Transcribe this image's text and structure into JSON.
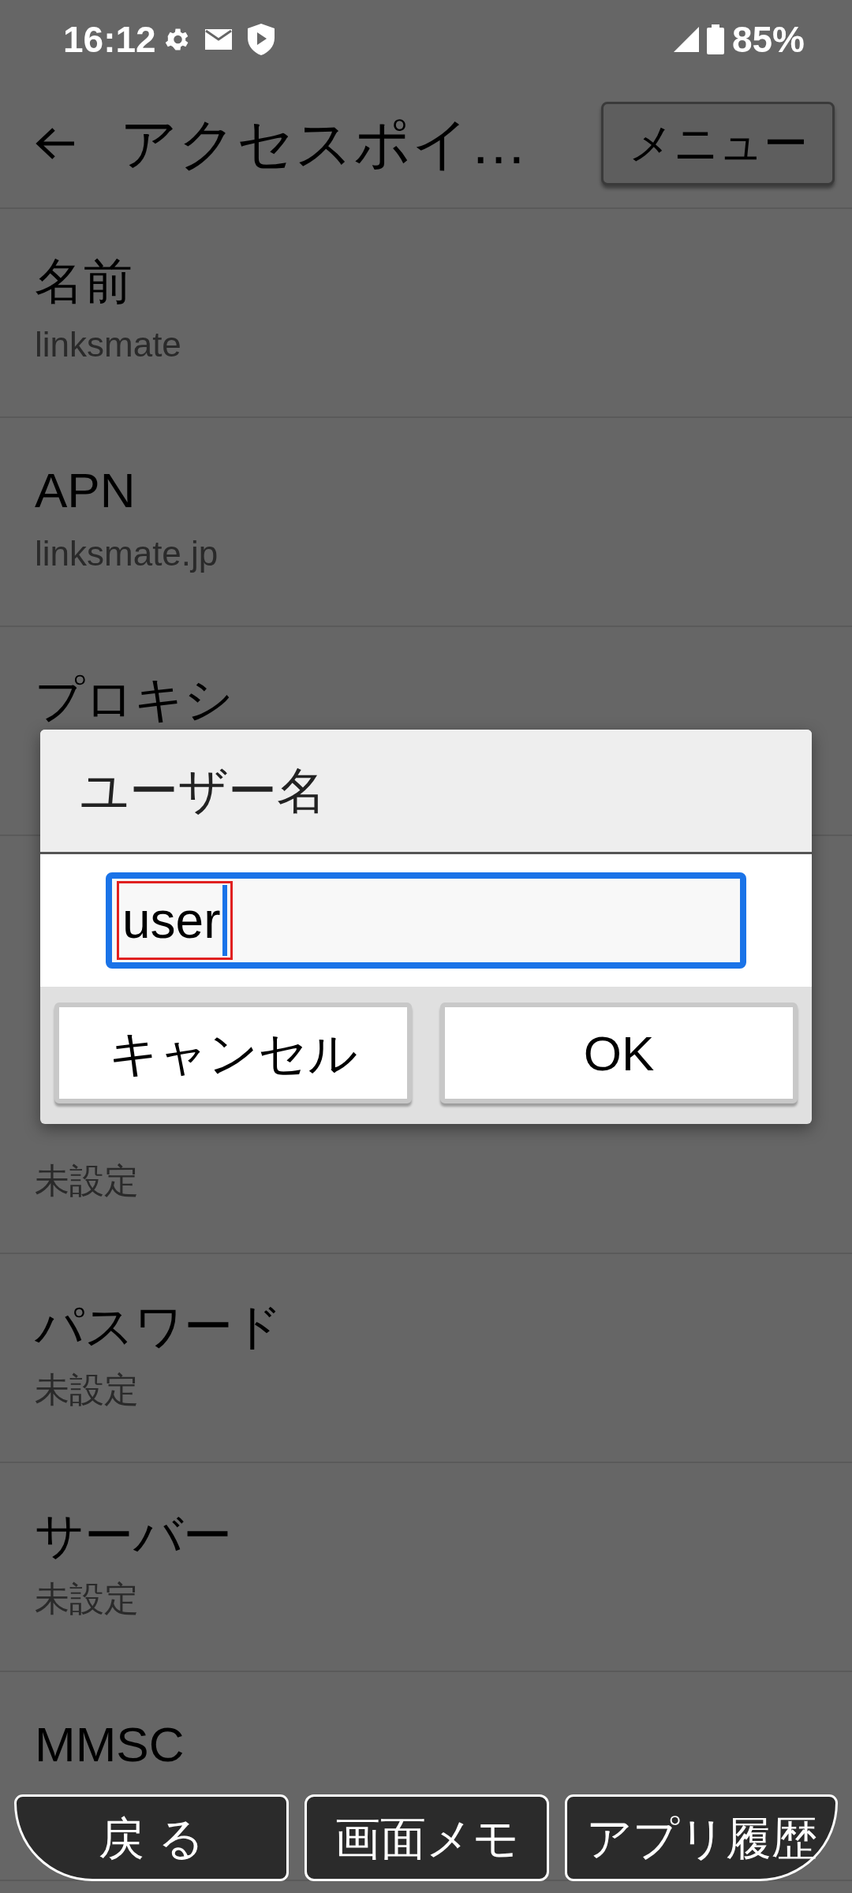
{
  "status_bar": {
    "time": "16:12",
    "battery": "85%"
  },
  "app_bar": {
    "title": "アクセスポイ…",
    "menu_button": "メニュー"
  },
  "settings": [
    {
      "label": "名前",
      "value": "linksmate"
    },
    {
      "label": "APN",
      "value": "linksmate.jp"
    },
    {
      "label": "プロキシ"
    }
  ],
  "settings_below_dialog": [
    {
      "value": "未設定"
    },
    {
      "label": "パスワード",
      "value": "未設定"
    },
    {
      "label": "サーバー",
      "value": "未設定"
    },
    {
      "label": "MMSC"
    }
  ],
  "dialog": {
    "title": "ユーザー名",
    "input": {
      "value": "user",
      "highlighted": true
    },
    "buttons": [
      "キャンセル",
      "OK"
    ]
  },
  "nav_buttons": [
    "戻 る",
    "画面メモ",
    "アプリ履歴"
  ]
}
